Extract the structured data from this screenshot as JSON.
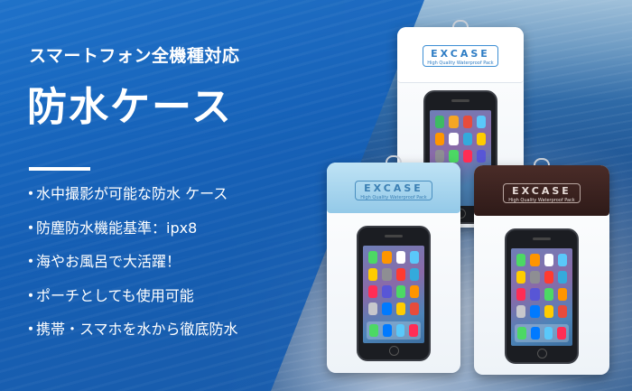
{
  "banner": {
    "subtitle": "スマートフォン全機種対応",
    "title": "防水ケース",
    "features": [
      "水中撮影が可能な防水 ケース",
      "防塵防水機能基準：ipx8",
      "海やお風呂で大活躍！",
      "ポーチとしても使用可能",
      "携帯・スマホを水から徹底防水"
    ],
    "bullet": "・"
  },
  "products": [
    {
      "name": "white",
      "flap_color": "#ffffff",
      "logo_brand": "EXCASE",
      "logo_sub": "High Quality Waterproof Pack"
    },
    {
      "name": "blue",
      "flap_color": "#a9d6ef",
      "logo_brand": "EXCASE",
      "logo_sub": "High Quality Waterproof Pack"
    },
    {
      "name": "brown",
      "flap_color": "#3a2220",
      "logo_brand": "EXCASE",
      "logo_sub": "High Quality Waterproof Pack"
    }
  ],
  "colors": {
    "panel_blue": "#1661b8",
    "text": "#ffffff",
    "logo_blue": "#2d7cc4"
  }
}
